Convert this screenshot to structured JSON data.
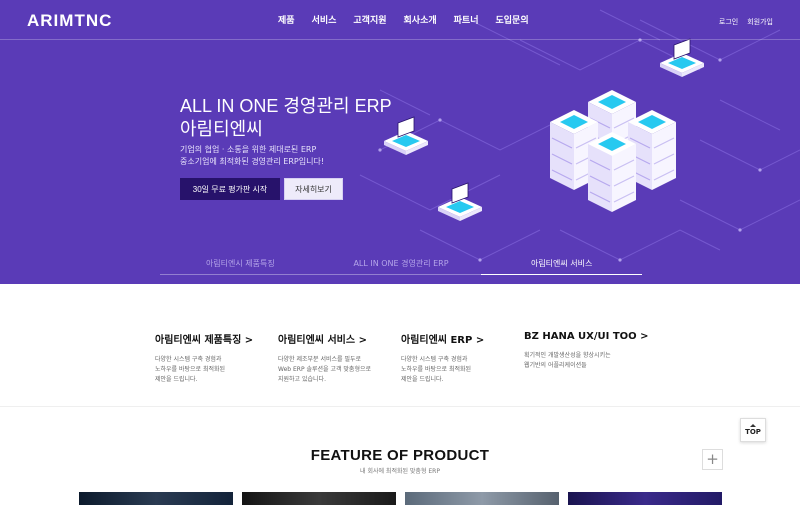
{
  "brand": {
    "logo_text": "ARIMTNC"
  },
  "nav": {
    "items": [
      "제품",
      "서비스",
      "고객지원",
      "회사소개",
      "파트너",
      "도입문의"
    ]
  },
  "util": {
    "login": "로그인",
    "signup": "회원가입"
  },
  "hero": {
    "title_line1": "ALL IN ONE 경영관리 ERP",
    "title_line2": "아림티엔씨",
    "desc_line1": "기업의 협업 · 소통을 위한 제대로된 ERP",
    "desc_line2": "중소기업에 최적화된 경영관리 ERP입니다!",
    "primary_button": "30일 무료 평가판 시작",
    "secondary_button": "자세히보기"
  },
  "tabs": [
    {
      "label": "아림티엔시 제품특징",
      "active": false
    },
    {
      "label": "ALL IN ONE 경영관리 ERP",
      "active": false
    },
    {
      "label": "아림티엔씨 서비스",
      "active": true
    }
  ],
  "features": [
    {
      "title": "아림티엔씨 제품특징 >",
      "desc": "다양한 시스템 구축 경험과\n노하우를 바탕으로 최적화된\n제안을 드립니다."
    },
    {
      "title": "아림티엔씨 서비스 >",
      "desc": "다양한 제조부분 서비스를 필두로\nWeb ERP 솔루션을 고객 맞춤형으로\n지원하고 있습니다."
    },
    {
      "title": "아림티엔씨 ERP >",
      "desc": "다양한 시스템 구축 경험과\n노하우를 바탕으로 최적화된\n제안을 드립니다."
    },
    {
      "title": "BZ HANA UX/UI TOO >",
      "desc": "획기적인 개발생산성을 향상시키는\n웹기반의 어플리케이션들"
    }
  ],
  "top_button": {
    "label": "TOP"
  },
  "product_section": {
    "title": "FEATURE OF PRODUCT",
    "subtitle": "내 회사에 최적화된 맞춤형 ERP",
    "plus": "+"
  },
  "colors": {
    "hero_bg": "#5a3bb7",
    "primary_button": "#27126b",
    "server_top": "#27c9f0",
    "server_body": "#f4f2ff"
  }
}
